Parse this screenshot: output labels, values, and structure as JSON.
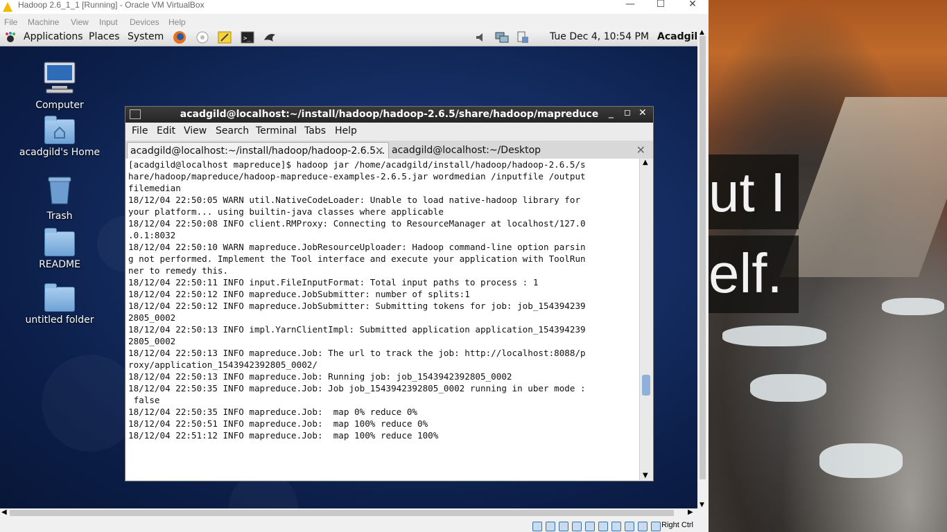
{
  "vbox": {
    "title": "Hadoop 2.6_1_1 [Running] - Oracle VM VirtualBox",
    "menu": [
      "File",
      "Machine",
      "View",
      "Input",
      "Devices",
      "Help"
    ],
    "controls": {
      "minimize": "—",
      "maximize": "☐",
      "close": "✕"
    },
    "status_host_key": "Right Ctrl"
  },
  "host_wallpaper": {
    "quote_line1": "ut I",
    "quote_line2": "elf."
  },
  "panel": {
    "menus": [
      "Applications",
      "Places",
      "System"
    ],
    "clock": "Tue Dec  4, 10:54 PM",
    "user": "Acadgil"
  },
  "desktop": {
    "icons": [
      "Computer",
      "acadgild's Home",
      "Trash",
      "README",
      "untitled folder"
    ]
  },
  "terminal": {
    "title": "acadgild@localhost:~/install/hadoop/hadoop-2.6.5/share/hadoop/mapreduce",
    "menu": [
      "File",
      "Edit",
      "View",
      "Search",
      "Terminal",
      "Tabs",
      "Help"
    ],
    "tabs": [
      "acadgild@localhost:~/install/hadoop/hadoop-2.6.5...",
      "acadgild@localhost:~/Desktop"
    ],
    "output": "[acadgild@localhost mapreduce]$ hadoop jar /home/acadgild/install/hadoop/hadoop-2.6.5/s\nhare/hadoop/mapreduce/hadoop-mapreduce-examples-2.6.5.jar wordmedian /inputfile /output\nfilemedian\n18/12/04 22:50:05 WARN util.NativeCodeLoader: Unable to load native-hadoop library for\nyour platform... using builtin-java classes where applicable\n18/12/04 22:50:08 INFO client.RMProxy: Connecting to ResourceManager at localhost/127.0\n.0.1:8032\n18/12/04 22:50:10 WARN mapreduce.JobResourceUploader: Hadoop command-line option parsin\ng not performed. Implement the Tool interface and execute your application with ToolRun\nner to remedy this.\n18/12/04 22:50:11 INFO input.FileInputFormat: Total input paths to process : 1\n18/12/04 22:50:12 INFO mapreduce.JobSubmitter: number of splits:1\n18/12/04 22:50:12 INFO mapreduce.JobSubmitter: Submitting tokens for job: job_154394239\n2805_0002\n18/12/04 22:50:13 INFO impl.YarnClientImpl: Submitted application application_154394239\n2805_0002\n18/12/04 22:50:13 INFO mapreduce.Job: The url to track the job: http://localhost:8088/p\nroxy/application_1543942392805_0002/\n18/12/04 22:50:13 INFO mapreduce.Job: Running job: job_1543942392805_0002\n18/12/04 22:50:35 INFO mapreduce.Job: Job job_1543942392805_0002 running in uber mode :\n false\n18/12/04 22:50:35 INFO mapreduce.Job:  map 0% reduce 0%\n18/12/04 22:50:51 INFO mapreduce.Job:  map 100% reduce 0%\n18/12/04 22:51:12 INFO mapreduce.Job:  map 100% reduce 100%"
  }
}
